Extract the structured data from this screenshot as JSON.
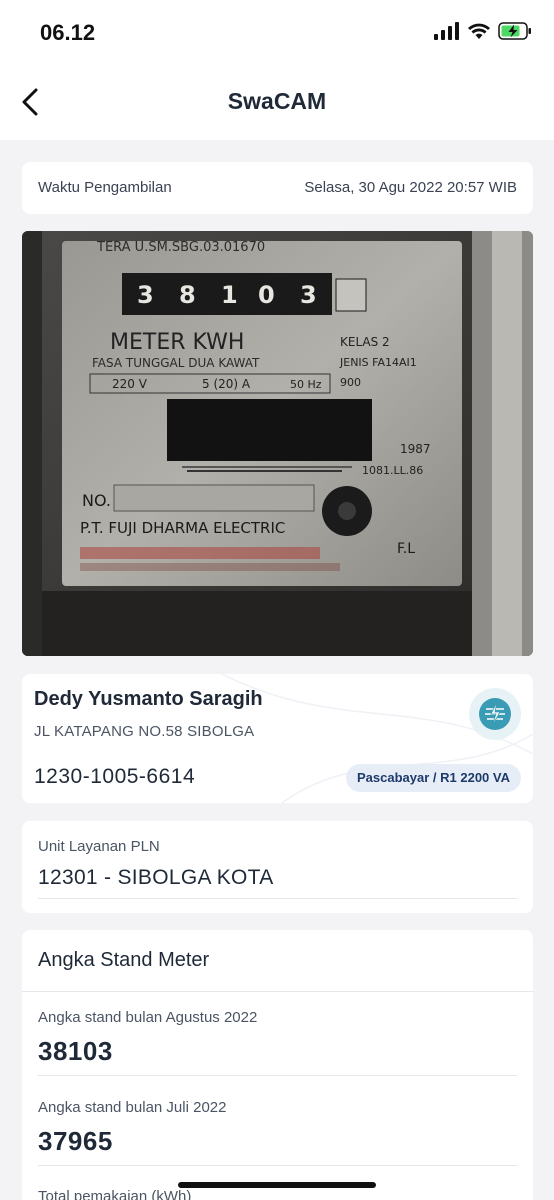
{
  "status_bar": {
    "time": "06.12"
  },
  "nav": {
    "title": "SwaCAM"
  },
  "capture": {
    "label": "Waktu Pengambilan",
    "value": "Selasa, 30 Agu 2022 20:57 WIB"
  },
  "meter_photo": {
    "serial": "TERA U.SM.SBG.03.01670",
    "digits": [
      "3",
      "8",
      "1",
      "0",
      "3"
    ],
    "title": "METER KWH",
    "subtitle": "FASA TUNGGAL DUA KAWAT",
    "voltage": "220  V",
    "current": "5 (20)  A",
    "freq": "50 Hz",
    "kelas": "KELAS    2",
    "jenis": "JENIS FA14AI1",
    "putaran": "900",
    "year": "1987",
    "code": "1081.LL.86",
    "no": "NO.",
    "manufacturer": "P.T. FUJI DHARMA ELECTRIC",
    "fl": "F.L"
  },
  "customer": {
    "name": "Dedy Yusmanto Saragih",
    "address": "JL KATAPANG NO.58 SIBOLGA",
    "id": "1230-1005-6614",
    "tariff": "Pascabayar / R1 2200 VA"
  },
  "unit": {
    "label": "Unit Layanan PLN",
    "value": "12301 - SIBOLGA KOTA"
  },
  "stand": {
    "title": "Angka Stand Meter",
    "rows": [
      {
        "label": "Angka stand bulan Agustus 2022",
        "value": "38103"
      },
      {
        "label": "Angka stand bulan Juli 2022",
        "value": "37965"
      },
      {
        "label": "Total pemakaian (kWh)"
      }
    ]
  },
  "colors": {
    "accent": "#3a9bb5",
    "background": "#f3f3f5",
    "badge_bg": "#e6edf6",
    "badge_text": "#1e3a6b"
  }
}
